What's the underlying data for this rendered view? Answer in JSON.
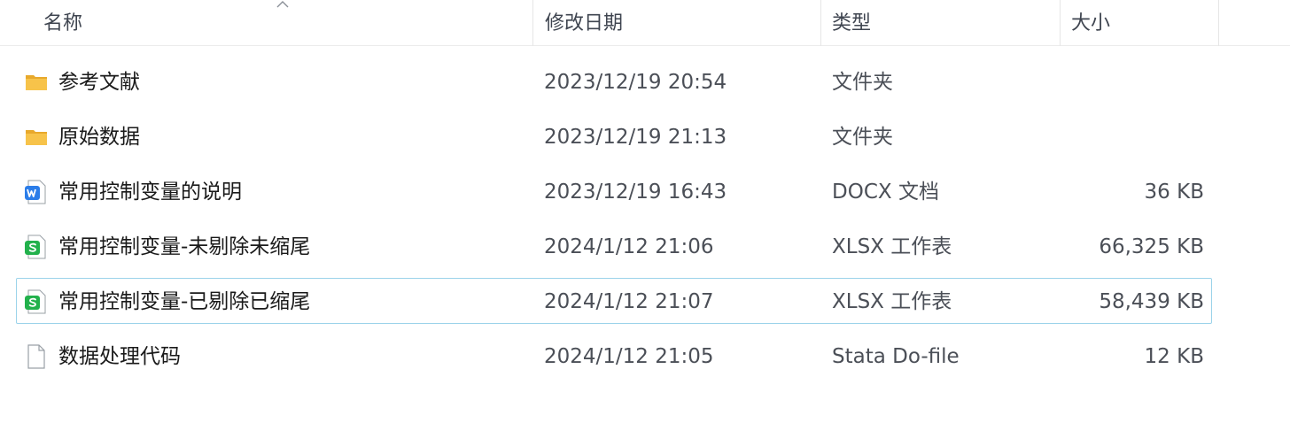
{
  "columns": {
    "name": "名称",
    "date": "修改日期",
    "type": "类型",
    "size": "大小"
  },
  "files": [
    {
      "name": "参考文献",
      "date": "2023/12/19 20:54",
      "type": "文件夹",
      "size": "",
      "icon": "folder-icon"
    },
    {
      "name": "原始数据",
      "date": "2023/12/19 21:13",
      "type": "文件夹",
      "size": "",
      "icon": "folder-icon"
    },
    {
      "name": "常用控制变量的说明",
      "date": "2023/12/19 16:43",
      "type": "DOCX 文档",
      "size": "36 KB",
      "icon": "wps-writer-icon"
    },
    {
      "name": "常用控制变量-未剔除未缩尾",
      "date": "2024/1/12 21:06",
      "type": "XLSX 工作表",
      "size": "66,325 KB",
      "icon": "wps-spreadsheet-icon"
    },
    {
      "name": "常用控制变量-已剔除已缩尾",
      "date": "2024/1/12 21:07",
      "type": "XLSX 工作表",
      "size": "58,439 KB",
      "icon": "wps-spreadsheet-icon"
    },
    {
      "name": "数据处理代码",
      "date": "2024/1/12 21:05",
      "type": "Stata Do-file",
      "size": "12 KB",
      "icon": "blank-file-icon"
    }
  ],
  "colors": {
    "folder": "#f7c34a",
    "writer": "#2b7de9",
    "spreadsheet": "#22b14c",
    "focus_border": "#9bd3ea"
  }
}
